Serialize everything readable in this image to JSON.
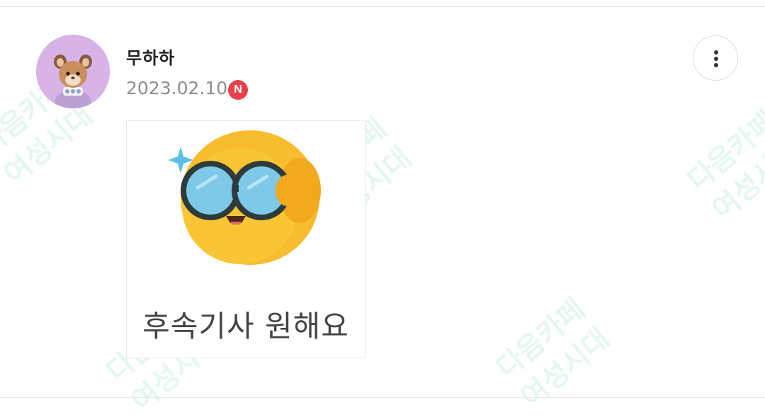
{
  "comment": {
    "author_name": "무하하",
    "date": "2023.02.10",
    "new_badge": "N",
    "sticker_caption": "후속기사 원해요",
    "avatar_icon": "rabbit-plush-avatar",
    "more_icon": "vertical-dots-icon"
  },
  "watermark": {
    "line1": "다음카페",
    "line2": "여성시대"
  },
  "colors": {
    "badge": "#e8414b",
    "watermark": "#a0ded4",
    "avatar_bg": "#d7b3e8",
    "emoji_face": "#f7bd2f"
  }
}
